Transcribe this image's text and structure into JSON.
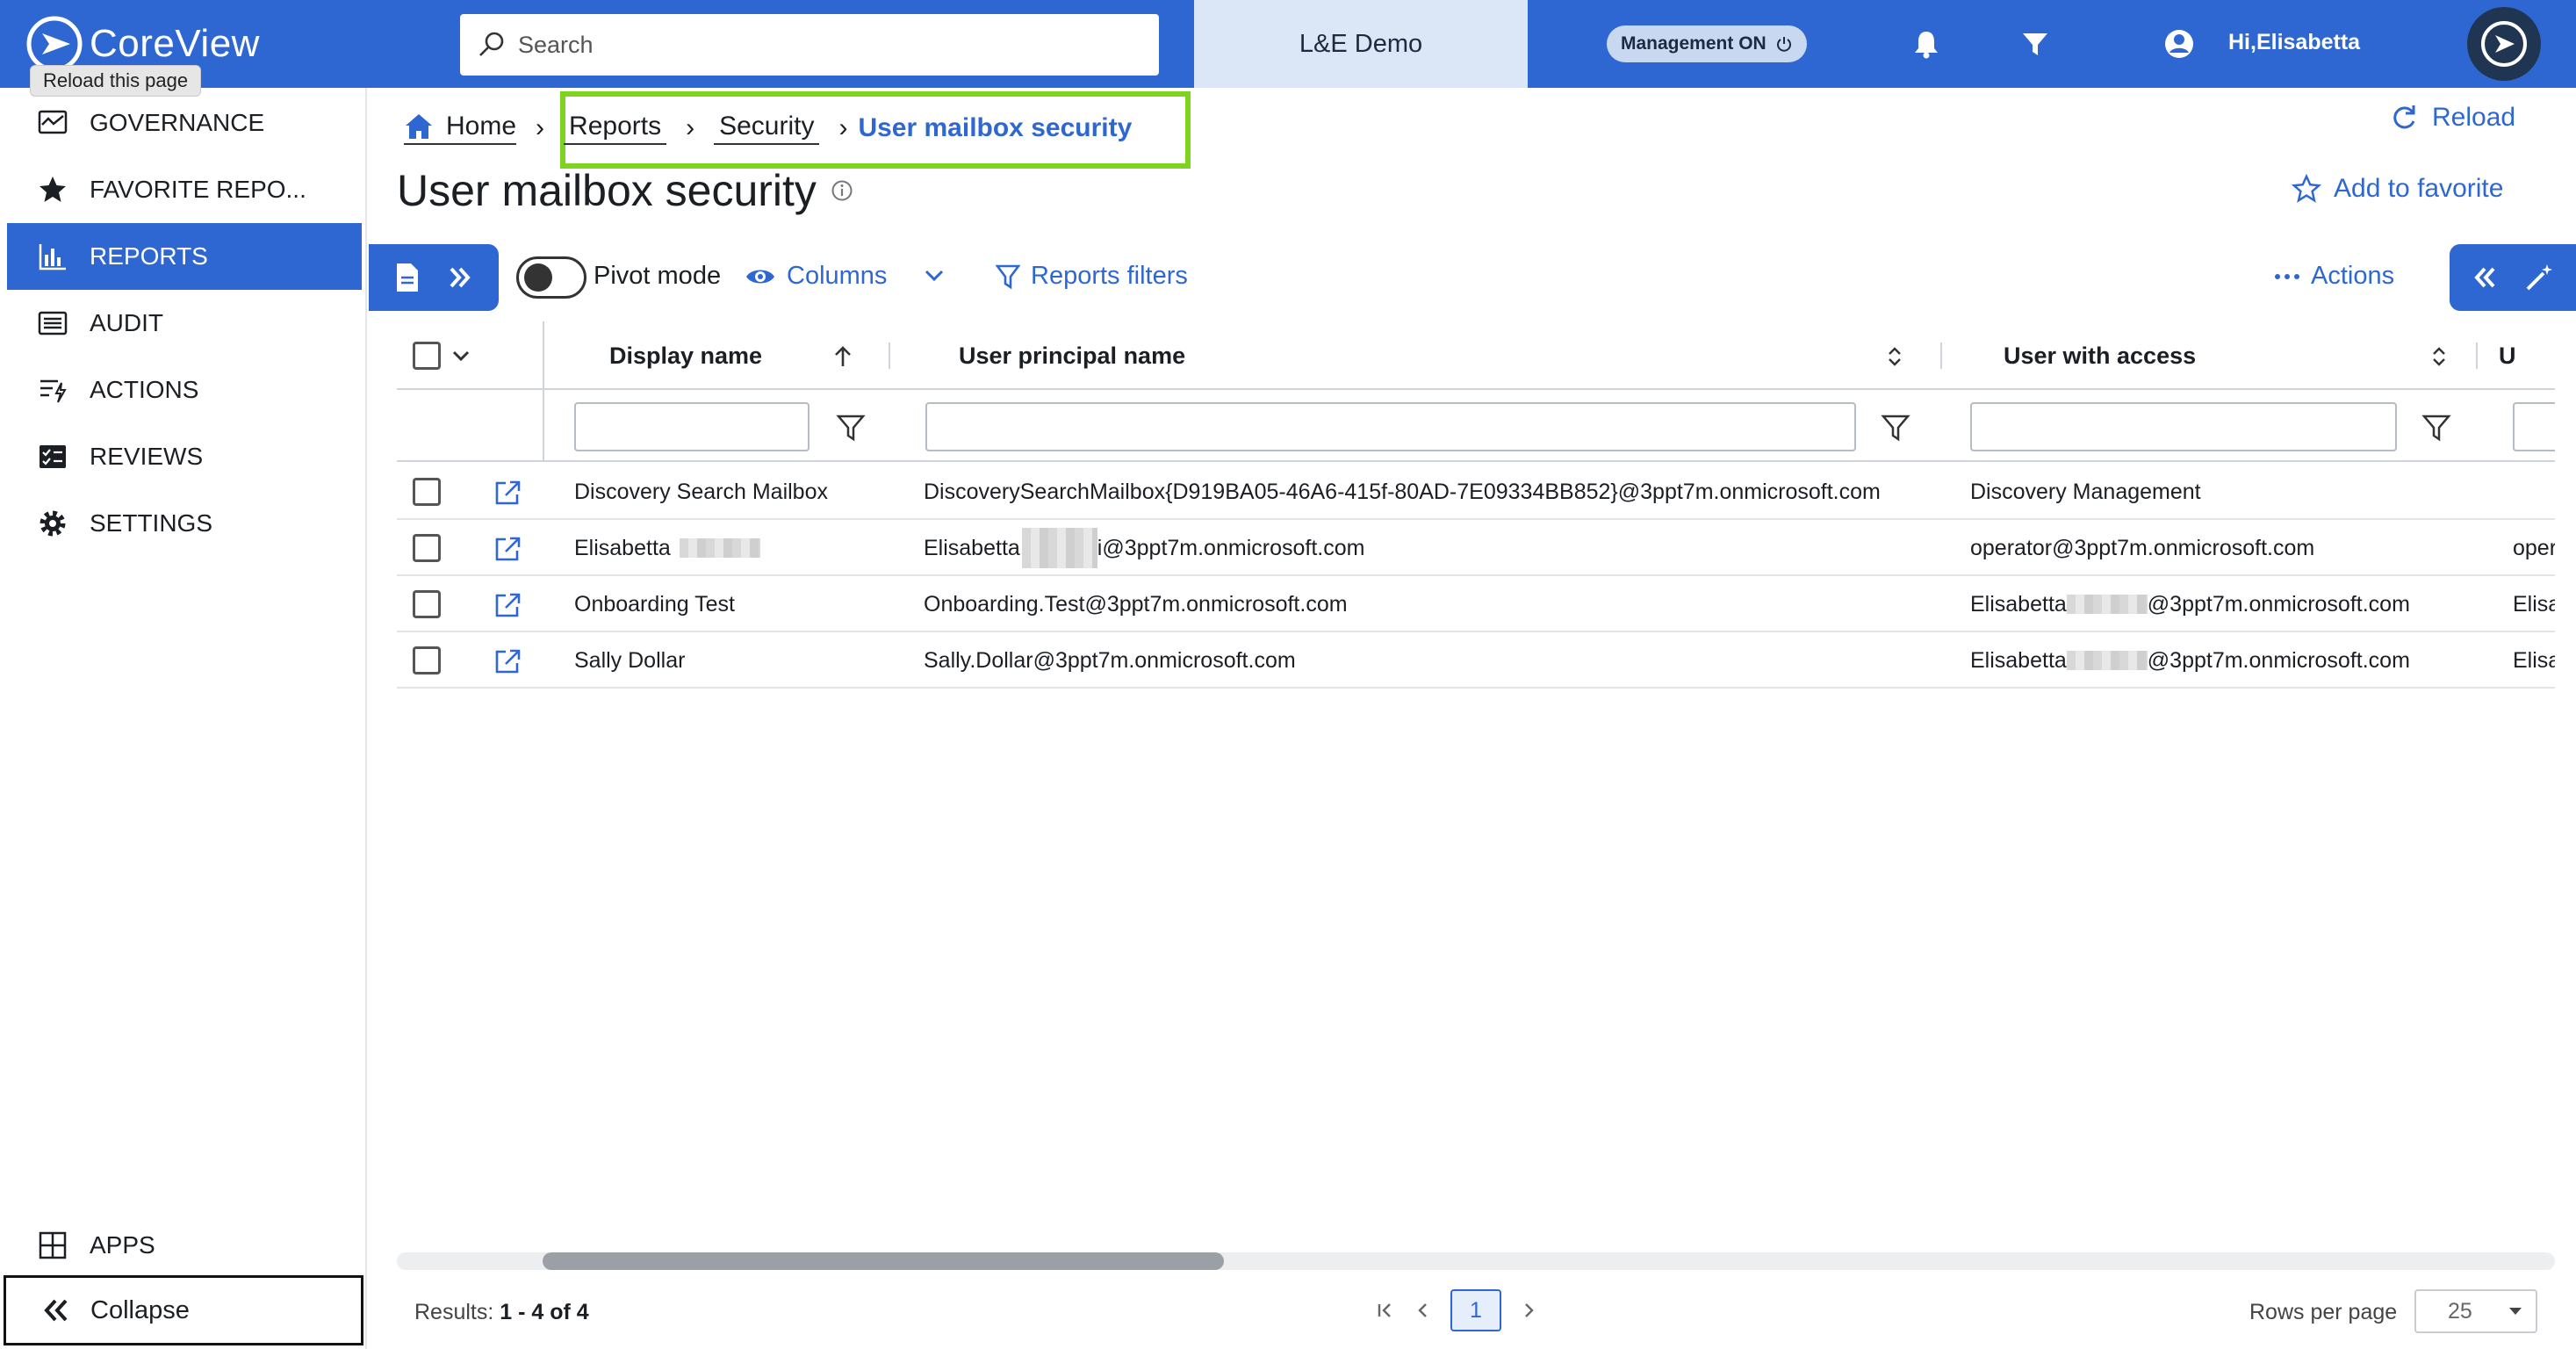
{
  "header": {
    "brand": "CoreView",
    "tooltip": "Reload this page",
    "search_placeholder": "Search",
    "tenant": "L&E Demo",
    "management_badge": "Management ON",
    "greeting": "Hi,Elisabetta"
  },
  "sidebar": {
    "items": [
      {
        "label": "GOVERNANCE",
        "icon": "governance-icon"
      },
      {
        "label": "FAVORITE REPO...",
        "icon": "star-icon"
      },
      {
        "label": "REPORTS",
        "icon": "bar-chart-icon",
        "active": true
      },
      {
        "label": "AUDIT",
        "icon": "list-icon"
      },
      {
        "label": "ACTIONS",
        "icon": "actions-icon"
      },
      {
        "label": "REVIEWS",
        "icon": "checklist-icon"
      },
      {
        "label": "SETTINGS",
        "icon": "gear-icon"
      }
    ],
    "apps_label": "APPS",
    "collapse_label": "Collapse"
  },
  "breadcrumb": {
    "home": "Home",
    "reports": "Reports",
    "security": "Security",
    "current": "User mailbox security"
  },
  "page": {
    "title": "User mailbox security",
    "reload_label": "Reload",
    "favorite_label": "Add to favorite"
  },
  "toolbar": {
    "pivot_label": "Pivot mode",
    "columns_label": "Columns",
    "filters_label": "Reports filters",
    "actions_label": "Actions"
  },
  "grid": {
    "columns": [
      "Display name",
      "User principal name",
      "User with access",
      "U"
    ],
    "rows": [
      {
        "display": "Discovery Search Mailbox",
        "upn": "DiscoverySearchMailbox{D919BA05-46A6-415f-80AD-7E09334BB852}@3ppt7m.onmicrosoft.com",
        "access": "Discovery Management",
        "extra": ""
      },
      {
        "display": "Elisabetta",
        "upn_pre": "Elisabetta",
        "upn_post": "i@3ppt7m.onmicrosoft.com",
        "access": "operator@3ppt7m.onmicrosoft.com",
        "extra": "oper"
      },
      {
        "display": "Onboarding Test",
        "upn": "Onboarding.Test@3ppt7m.onmicrosoft.com",
        "access_pre": "Elisabetta",
        "access_post": "@3ppt7m.onmicrosoft.com",
        "extra": "Elisa"
      },
      {
        "display": "Sally Dollar",
        "upn": "Sally.Dollar@3ppt7m.onmicrosoft.com",
        "access_pre": "Elisabetta",
        "access_post": "@3ppt7m.onmicrosoft.com",
        "extra": "Elisa"
      }
    ]
  },
  "footer": {
    "results_label": "Results:",
    "results_value": "1 - 4 of 4",
    "current_page": "1",
    "rows_per_page_label": "Rows per page",
    "rows_per_page_value": "25"
  },
  "colors": {
    "brand": "#2f67d2",
    "highlight": "#7ed321"
  }
}
